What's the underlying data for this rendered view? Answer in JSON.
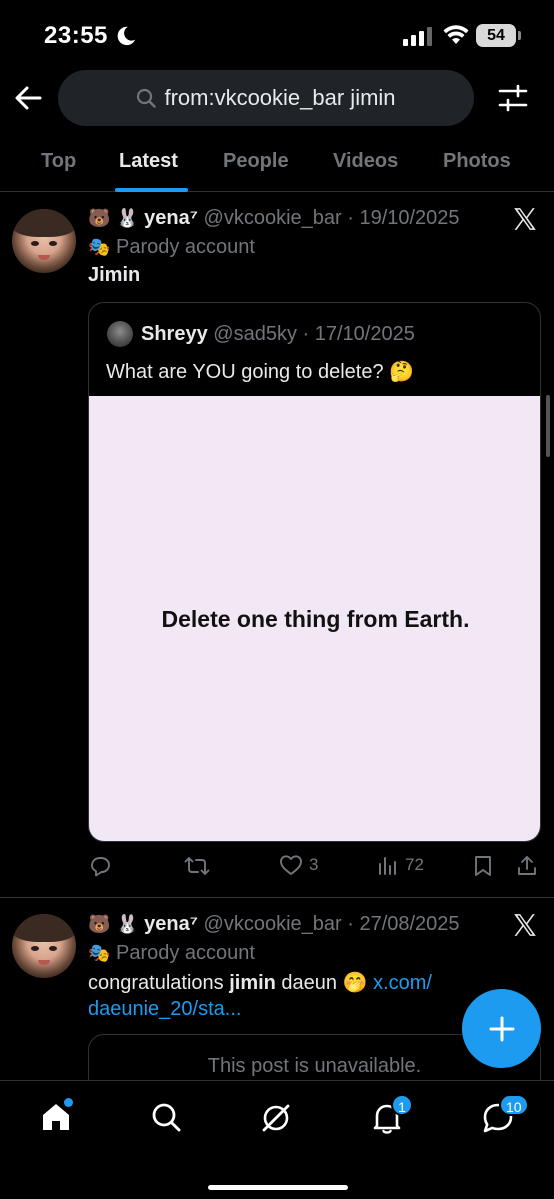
{
  "status_bar": {
    "time": "23:55",
    "battery": "54"
  },
  "search": {
    "query": "from:vkcookie_bar jimin"
  },
  "tabs": [
    {
      "label": "Top",
      "active": false
    },
    {
      "label": "Latest",
      "active": true
    },
    {
      "label": "People",
      "active": false
    },
    {
      "label": "Videos",
      "active": false
    },
    {
      "label": "Photos",
      "active": false
    }
  ],
  "posts": [
    {
      "emojis": "🐻 🐰",
      "name": "yena⁷",
      "handle": "@vkcookie_bar",
      "date": "19/10/2025",
      "parody_label": "Parody account",
      "text": "Jimin",
      "quote": {
        "name": "Shreyy",
        "handle": "@sad5ky",
        "date": "17/10/2025",
        "text": "What are YOU going to delete? 🤔",
        "image_text": "Delete one thing from Earth."
      },
      "stats": {
        "likes": "3",
        "views": "72"
      }
    },
    {
      "emojis": "🐻 🐰",
      "name": "yena⁷",
      "handle": "@vkcookie_bar",
      "date": "27/08/2025",
      "parody_label": "Parody account",
      "text_pre": "congratulations ",
      "text_bold": "jimin",
      "text_post": " daeun 🤭 ",
      "link_line1": "x.com/",
      "link_line2": "daeunie_20/sta...",
      "unavailable_text": "This post is unavailable."
    }
  ],
  "bottom_nav": {
    "notifications_badge": "1",
    "messages_badge": "10"
  },
  "colors": {
    "accent": "#1d9bf0",
    "background": "#000000",
    "muted": "#71767b",
    "quote_image_bg": "#f2e7f5"
  }
}
